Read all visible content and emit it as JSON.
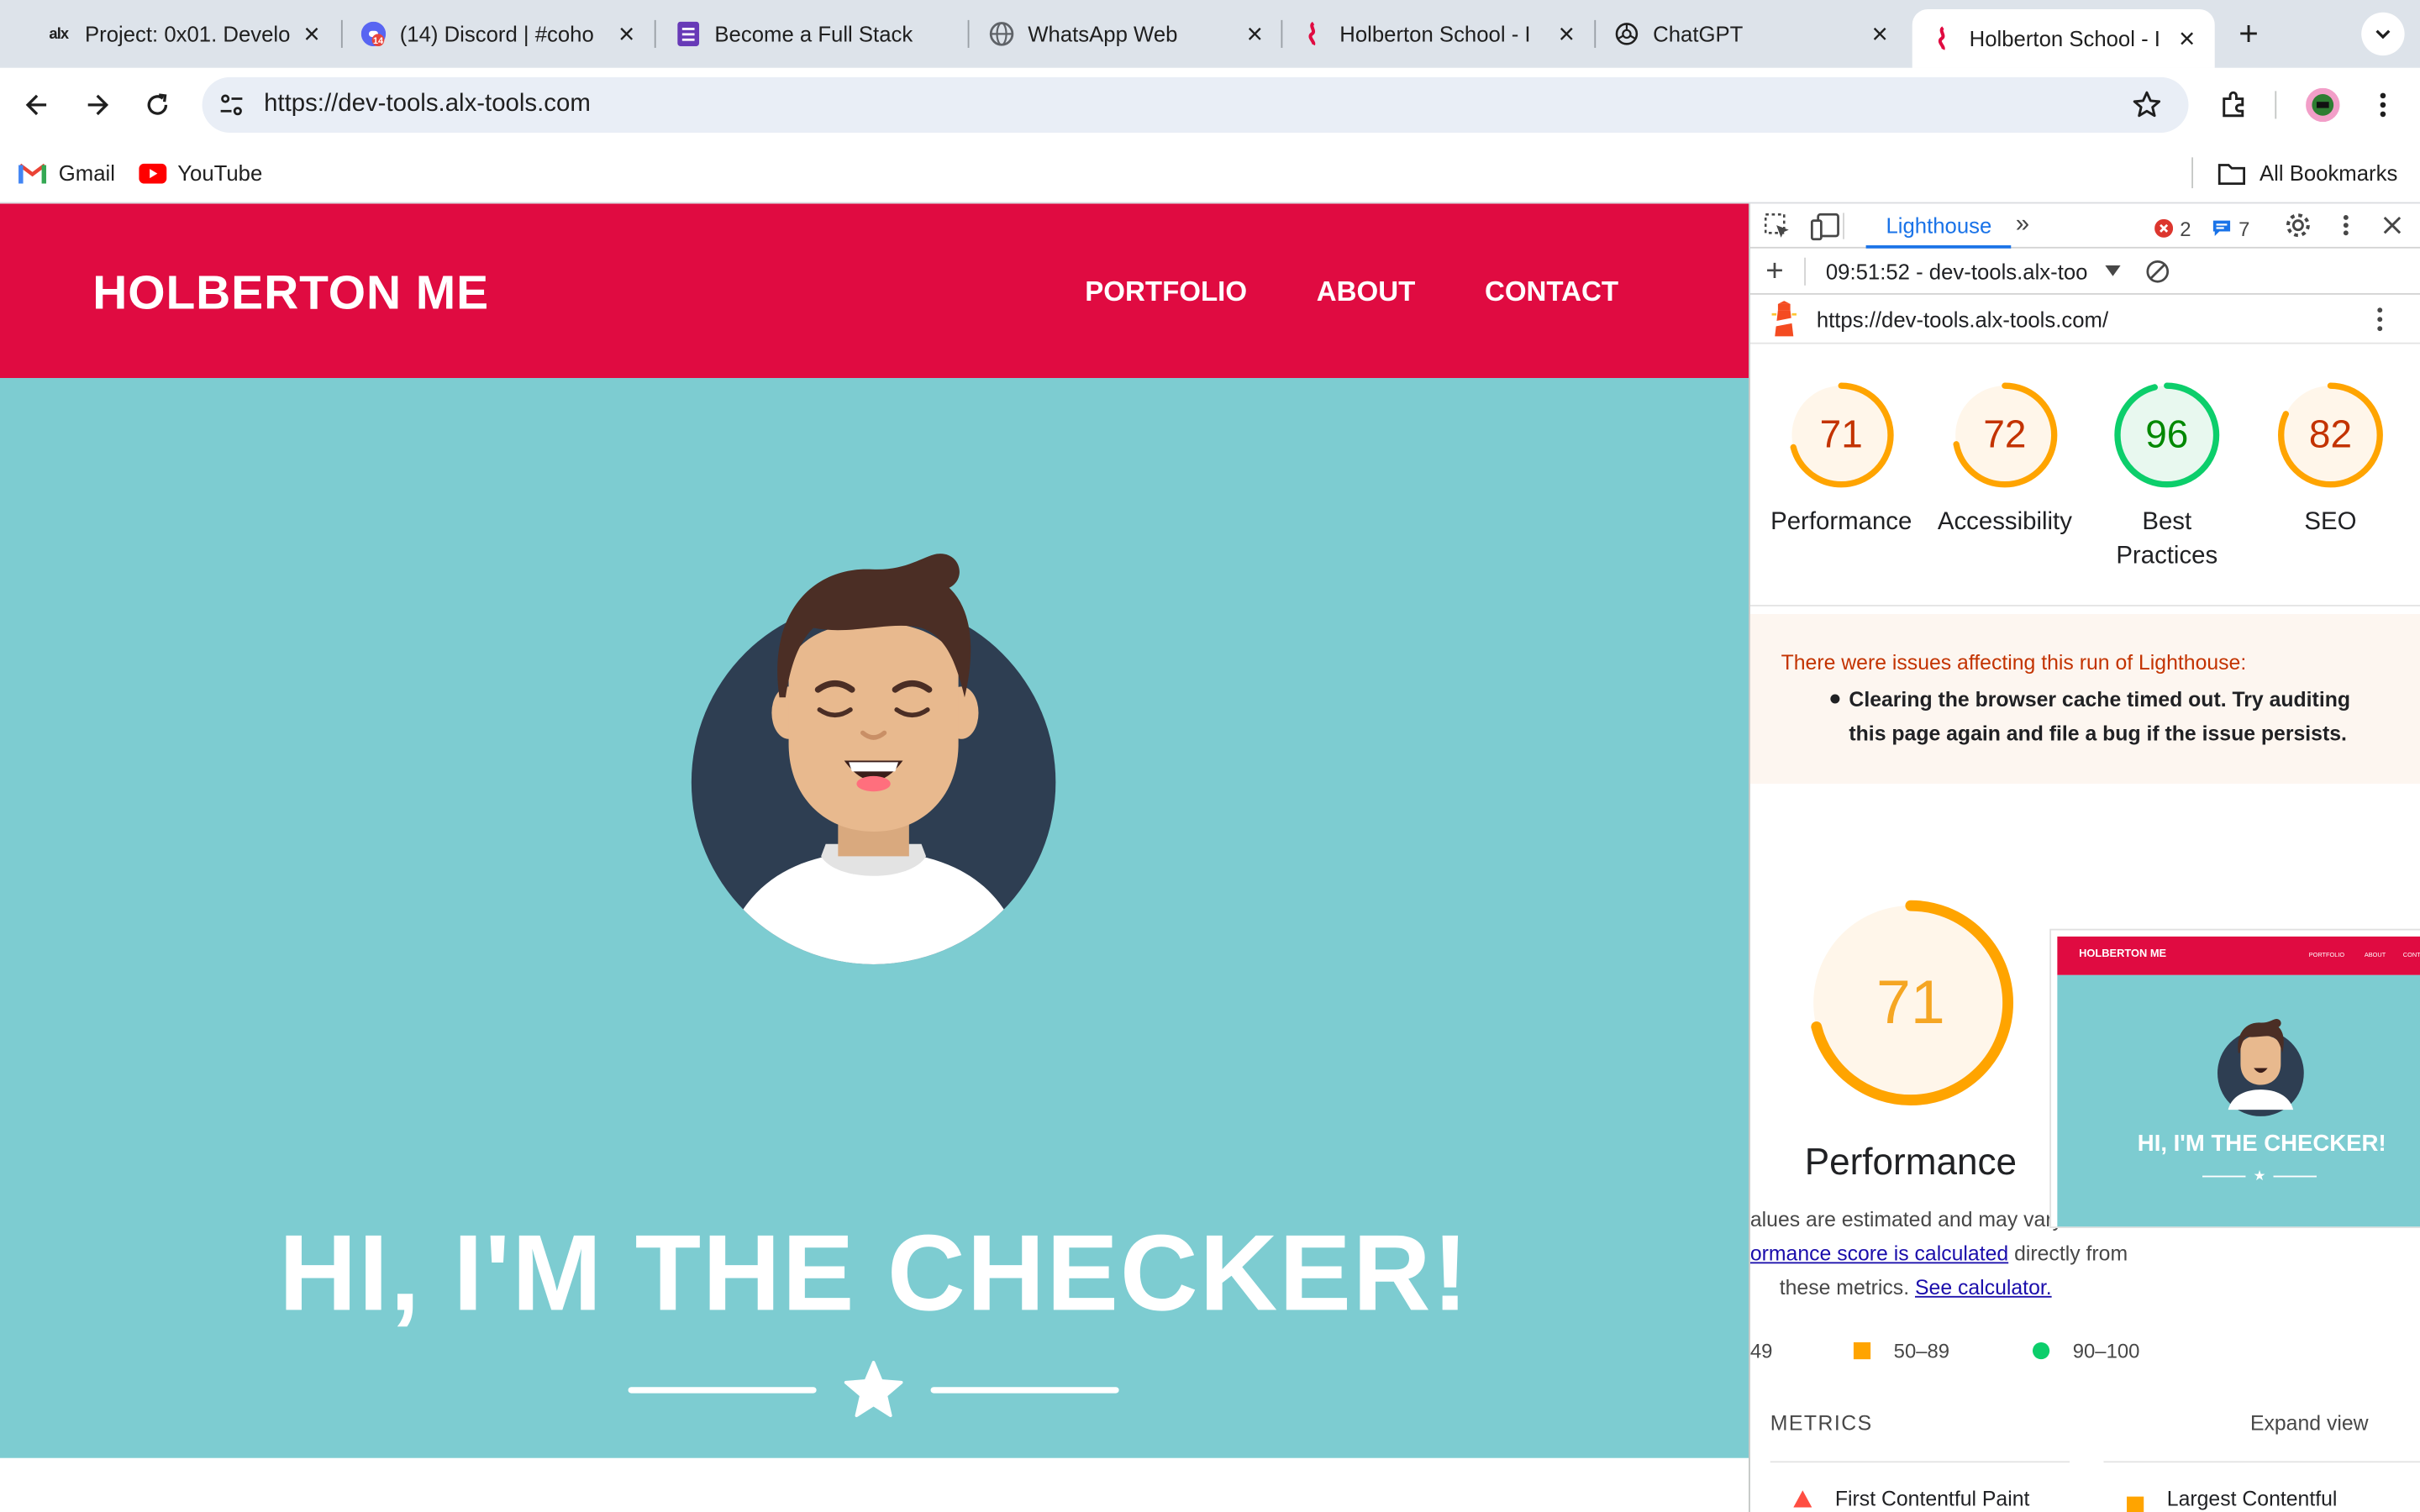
{
  "browser": {
    "tabs": [
      {
        "title": "Project: 0x01. Develo",
        "favicon": "alx-logo"
      },
      {
        "title": "(14) Discord | #coho",
        "favicon": "discord-icon",
        "badge": "14"
      },
      {
        "title": "Become a Full Stack",
        "favicon": "forms-icon"
      },
      {
        "title": "WhatsApp Web",
        "favicon": "globe-icon"
      },
      {
        "title": "Holberton School - I",
        "favicon": "holberton-icon"
      },
      {
        "title": "ChatGPT",
        "favicon": "chatgpt-icon"
      },
      {
        "title": "Holberton School - I",
        "favicon": "holberton-icon",
        "active": true
      }
    ],
    "url": "https://dev-tools.alx-tools.com",
    "bookmarks": [
      {
        "label": "Gmail",
        "icon": "gmail-icon"
      },
      {
        "label": "YouTube",
        "icon": "youtube-icon"
      }
    ],
    "all_bookmarks": "All Bookmarks"
  },
  "site": {
    "brand": "HOLBERTON ME",
    "nav": [
      "PORTFOLIO",
      "ABOUT",
      "CONTACT"
    ],
    "hero_title": "HI, I'M THE CHECKER!",
    "colors": {
      "header": "#e00b41",
      "hero": "#7dccd1"
    }
  },
  "devtools": {
    "panel_tab": "Lighthouse",
    "errors": "2",
    "messages": "7",
    "report_time": "09:51:52 - dev-tools.alx-too",
    "report_url": "https://dev-tools.alx-tools.com/",
    "scores": [
      {
        "value": 71,
        "label": "Performance",
        "color": "#ffa400"
      },
      {
        "value": 72,
        "label": "Accessibility",
        "color": "#ffa400"
      },
      {
        "value": 96,
        "label": "Best Practices",
        "color": "#0cce6b"
      },
      {
        "value": 82,
        "label": "SEO",
        "color": "#ffa400"
      }
    ],
    "issues_heading": "There were issues affecting this run of Lighthouse:",
    "issues_item": "Clearing the browser cache timed out. Try auditing this page again and file a bug if the issue persists.",
    "perf_score": 71,
    "perf_label": "Performance",
    "perf_note_1": "alues are estimated and may vary. T",
    "perf_note_link": "ormance score is calculated",
    "perf_note_2": " directly from",
    "perf_note_3": "these metrics. ",
    "perf_note_calc": "See calculator.",
    "legend": [
      {
        "range": "49",
        "shape": "triangle",
        "color": "#ff4e42"
      },
      {
        "range": "50–89",
        "shape": "square",
        "color": "#ffa400"
      },
      {
        "range": "90–100",
        "shape": "circle",
        "color": "#0cce6b"
      }
    ],
    "metrics_heading": "METRICS",
    "expand_view": "Expand view",
    "metric_1": "First Contentful Paint",
    "metric_2": "Largest Contentful"
  }
}
